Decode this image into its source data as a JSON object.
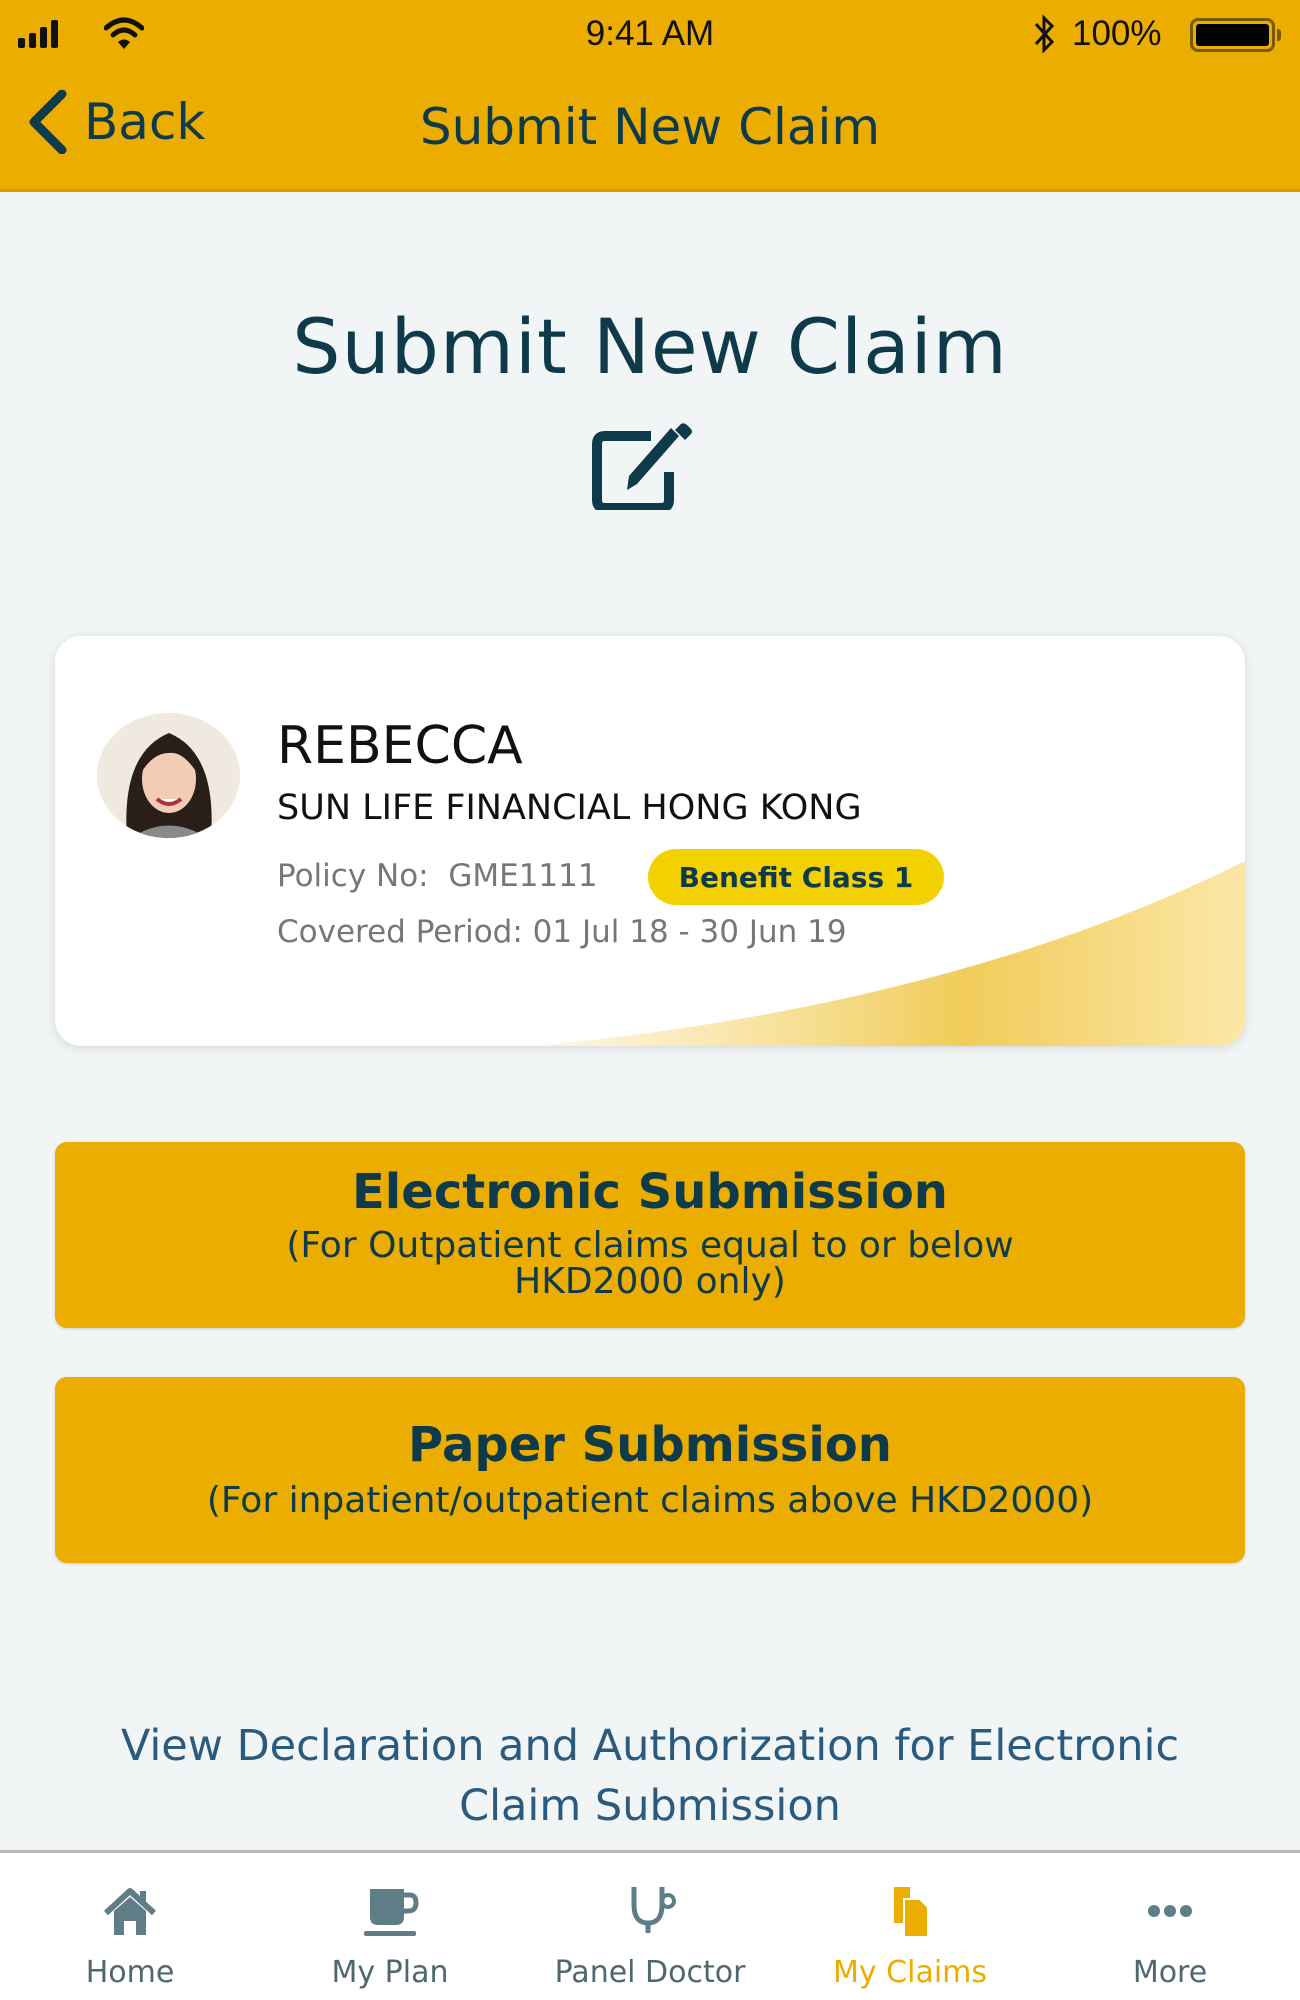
{
  "status_bar": {
    "time": "9:41 AM",
    "battery": "100%"
  },
  "nav": {
    "back_label": "Back",
    "title": "Submit New Claim"
  },
  "page": {
    "title": "Submit New Claim",
    "icon": "edit-icon"
  },
  "member_card": {
    "name": "REBECCA",
    "company": "SUN LIFE FINANCIAL HONG KONG",
    "policy_label": "Policy No:",
    "policy_no": "GME1111",
    "benefit_class": "Benefit Class 1",
    "covered_period": "Covered Period: 01 Jul 18 - 30 Jun 19"
  },
  "options": {
    "electronic": {
      "title": "Electronic Submission",
      "subtitle": "(For Outpatient claims equal to or below HKD2000 only)"
    },
    "paper": {
      "title": "Paper Submission",
      "subtitle": "(For inpatient/outpatient claims above HKD2000)"
    }
  },
  "declaration_link": "View Declaration and Authorization for Electronic Claim Submission",
  "tabbar": {
    "items": [
      {
        "label": "Home",
        "icon": "home-icon"
      },
      {
        "label": "My Plan",
        "icon": "cup-icon"
      },
      {
        "label": "Panel Doctor",
        "icon": "stethoscope-icon"
      },
      {
        "label": "My Claims",
        "icon": "documents-icon",
        "active": true
      },
      {
        "label": "More",
        "icon": "more-icon"
      }
    ]
  },
  "colors": {
    "brand": "#eaad00",
    "text_dark": "#0e3a4a",
    "badge": "#f3d100",
    "link": "#2a5a7e",
    "tab_inactive": "#4e6770"
  }
}
